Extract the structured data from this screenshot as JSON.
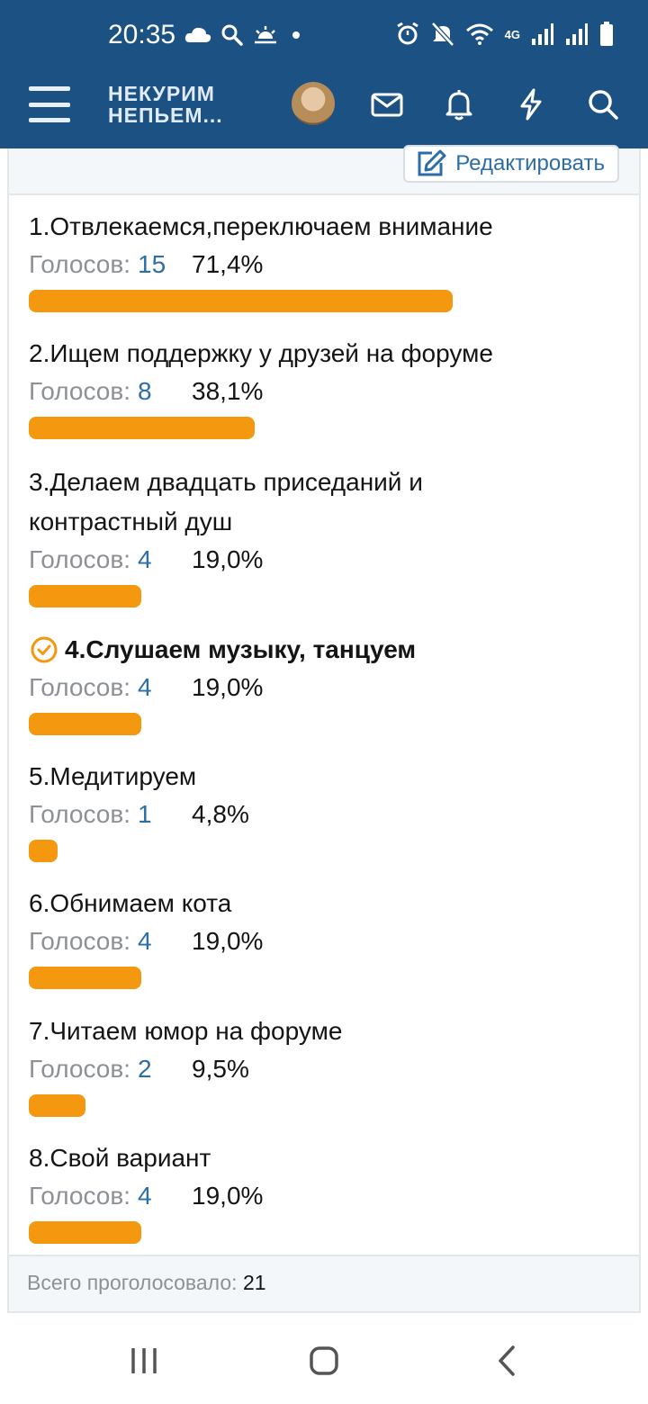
{
  "status_bar": {
    "time": "20:35",
    "network": "4G"
  },
  "app_bar": {
    "logo_line1": "НЕКУРИМ",
    "logo_line2": "НЕПЬЕМ..."
  },
  "poll": {
    "edit_label": "Редактировать",
    "votes_label": "Голосов:",
    "bar_color": "#f3980f",
    "options": [
      {
        "title": "1.Отвлекаемся,переключаем внимание",
        "votes": "15",
        "percent": "71,4%",
        "fraction": 0.714
      },
      {
        "title": "2.Ищем поддержку у друзей на форуме",
        "votes": "8",
        "percent": "38,1%",
        "fraction": 0.381
      },
      {
        "title": "3.Делаем двадцать приседаний и контрастный душ",
        "votes": "4",
        "percent": "19,0%",
        "fraction": 0.19
      },
      {
        "title": "4.Слушаем музыку, танцуем",
        "votes": "4",
        "percent": "19,0%",
        "fraction": 0.19,
        "selected": true
      },
      {
        "title": "5.Медитируем",
        "votes": "1",
        "percent": "4,8%",
        "fraction": 0.048
      },
      {
        "title": "6.Обнимаем кота",
        "votes": "4",
        "percent": "19,0%",
        "fraction": 0.19
      },
      {
        "title": "7.Читаем юмор на форуме",
        "votes": "2",
        "percent": "9,5%",
        "fraction": 0.095
      },
      {
        "title": "8.Свой вариант",
        "votes": "4",
        "percent": "19,0%",
        "fraction": 0.19
      }
    ],
    "total_label": "Всего проголосовало:",
    "total": "21"
  },
  "icons": {
    "menu": "hamburger-menu-icon",
    "messages": "envelope-icon",
    "alerts": "bell-icon",
    "whats_new": "lightning-icon",
    "search": "search-icon",
    "selected": "check-circle-icon"
  },
  "colors": {
    "header": "#1c5283",
    "accent_blue": "#2b6ea8",
    "bar": "#f3980f"
  }
}
